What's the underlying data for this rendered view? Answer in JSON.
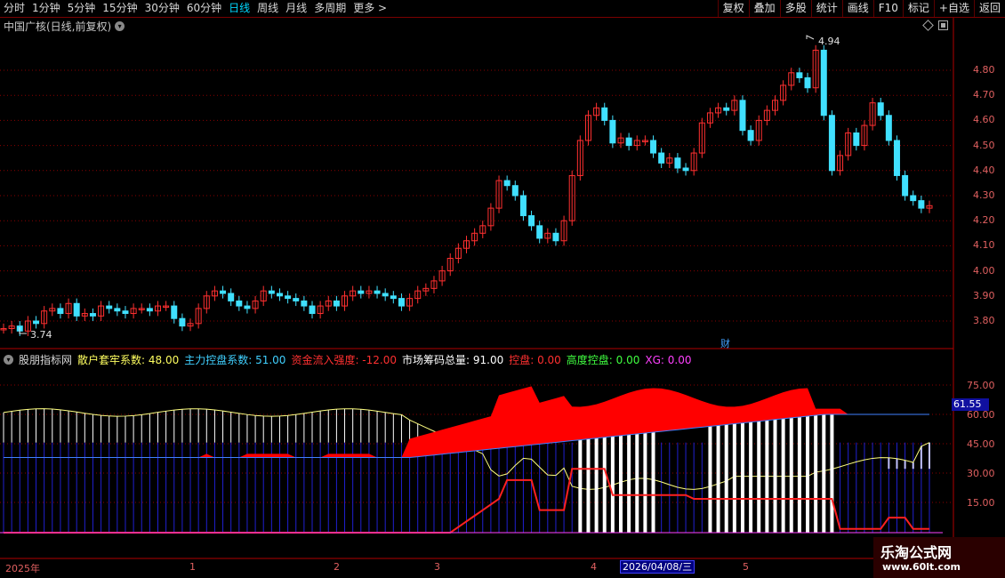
{
  "toolbar": {
    "periods": [
      "分时",
      "1分钟",
      "5分钟",
      "15分钟",
      "30分钟",
      "60分钟",
      "日线",
      "周线",
      "月线",
      "多周期",
      "更多 >"
    ],
    "active_period": "日线",
    "right_buttons": [
      "复权",
      "叠加",
      "多股",
      "统计",
      "画线",
      "F10",
      "标记",
      "+自选",
      "返回"
    ]
  },
  "main_chart": {
    "title": "中国广核(日线,前复权)",
    "high_label": "4.94",
    "low_label": "3.74",
    "marker": "财",
    "yaxis_ticks": [
      "4.80",
      "4.70",
      "4.60",
      "4.50",
      "4.40",
      "4.30",
      "4.20",
      "4.10",
      "4.00",
      "3.90",
      "3.80"
    ],
    "colors": {
      "up": "#ff3030",
      "down": "#40e0ff",
      "grid": "#8a0000"
    }
  },
  "indicator": {
    "name": "股朋指标网",
    "items": [
      {
        "label": "散户套牢系数: 48.00",
        "color": "#ffff60"
      },
      {
        "label": "主力控盘系数: 51.00",
        "color": "#40d0ff"
      },
      {
        "label": "资金流入强度: -12.00",
        "color": "#ff3030"
      },
      {
        "label": "市场筹码总量: 91.00",
        "color": "#ffffff"
      },
      {
        "label": "控盘: 0.00",
        "color": "#ff3030"
      },
      {
        "label": "高度控盘: 0.00",
        "color": "#40ff40"
      },
      {
        "label": "XG: 0.00",
        "color": "#ff40ff"
      }
    ],
    "yaxis_ticks": [
      "75.00",
      "60.00",
      "45.00",
      "30.00",
      "15.00"
    ],
    "current_value": "61.55"
  },
  "date_axis": {
    "labels": [
      "2025年",
      "1",
      "2",
      "3",
      "4",
      "5"
    ],
    "cursor_date": "2026/04/08/三"
  },
  "watermark": {
    "line1": "乐淘公式网",
    "line2": "www.60lt.com"
  }
}
